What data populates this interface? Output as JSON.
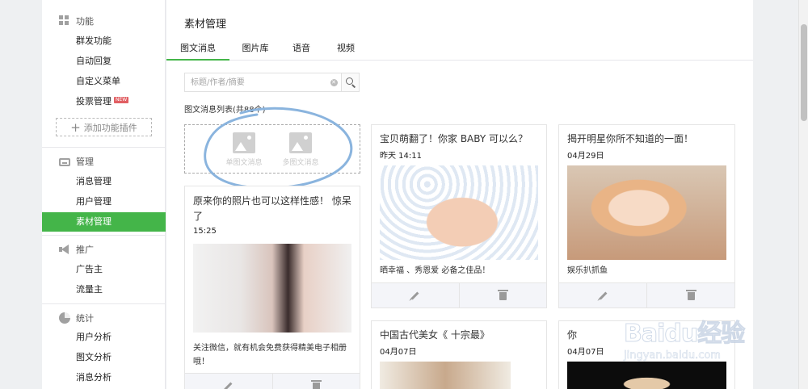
{
  "sidebar": {
    "groups": [
      {
        "title": "功能",
        "icon": "grid-icon",
        "items": [
          {
            "label": "群发功能"
          },
          {
            "label": "自动回复"
          },
          {
            "label": "自定义菜单"
          },
          {
            "label": "投票管理",
            "badge": "NEW"
          }
        ],
        "add_plugin_label": "添加功能插件"
      },
      {
        "title": "管理",
        "icon": "tray-icon",
        "items": [
          {
            "label": "消息管理"
          },
          {
            "label": "用户管理"
          },
          {
            "label": "素材管理",
            "active": true
          }
        ]
      },
      {
        "title": "推广",
        "icon": "megaphone-icon",
        "items": [
          {
            "label": "广告主"
          },
          {
            "label": "流量主"
          }
        ]
      },
      {
        "title": "统计",
        "icon": "pie-chart-icon",
        "items": [
          {
            "label": "用户分析"
          },
          {
            "label": "图文分析"
          },
          {
            "label": "消息分析"
          }
        ]
      }
    ]
  },
  "main": {
    "title": "素材管理",
    "tabs": [
      {
        "label": "图文消息",
        "active": true
      },
      {
        "label": "图片库"
      },
      {
        "label": "语音"
      },
      {
        "label": "视频"
      }
    ],
    "search": {
      "placeholder": "标题/作者/摘要",
      "value": ""
    },
    "list_title": "图文消息列表(共88个)",
    "add_options": {
      "single": "单图文消息",
      "multi": "多图文消息"
    },
    "accent_color": "#44b549",
    "cards": [
      {
        "title": "原来你的照片也可以这样性感！ 惊呆了",
        "date": "15:25",
        "desc": "关注微信，就有机会免费获得精美电子相册哦！"
      },
      {
        "title": "宝贝萌翻了！你家 BABY 可以么？",
        "date": "昨天 14:11",
        "desc": "晒幸福 、秀恩爱 必备之佳品！"
      },
      {
        "title": "揭开明星你所不知道的一面！",
        "date": "04月29日",
        "desc": "娱乐扒抓鱼"
      },
      {
        "title": "中国古代美女《 十宗最》",
        "date": "04月07日"
      },
      {
        "title": "你",
        "date": "04月07日"
      }
    ]
  },
  "watermark": {
    "main": "Baidu经验",
    "sub": "jingyan.baidu.com"
  }
}
